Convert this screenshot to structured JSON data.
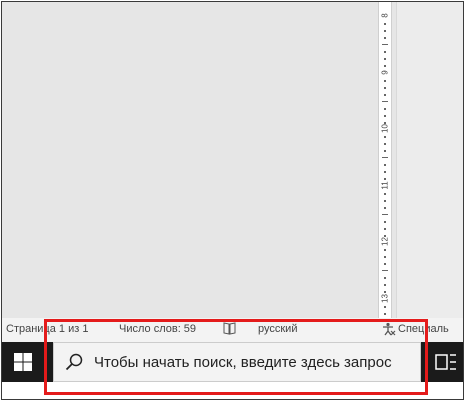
{
  "ruler": {
    "numbers": [
      "8",
      "9",
      "10",
      "11",
      "12",
      "13"
    ]
  },
  "status_bar": {
    "page": "Страница 1 из 1",
    "words": "Число слов: 59",
    "language": "русский",
    "accessibility": "Специаль"
  },
  "taskbar": {
    "search_placeholder": "Чтобы начать поиск, введите здесь запрос"
  },
  "colors": {
    "highlight": "#e41b1b",
    "taskbar": "#1b1b1b",
    "doc_background": "#e6e6e6"
  },
  "icons": {
    "start": "windows-logo",
    "search": "search-icon",
    "proofing": "book-icon",
    "accessibility": "accessibility-icon",
    "task_view": "task-view-icon"
  }
}
